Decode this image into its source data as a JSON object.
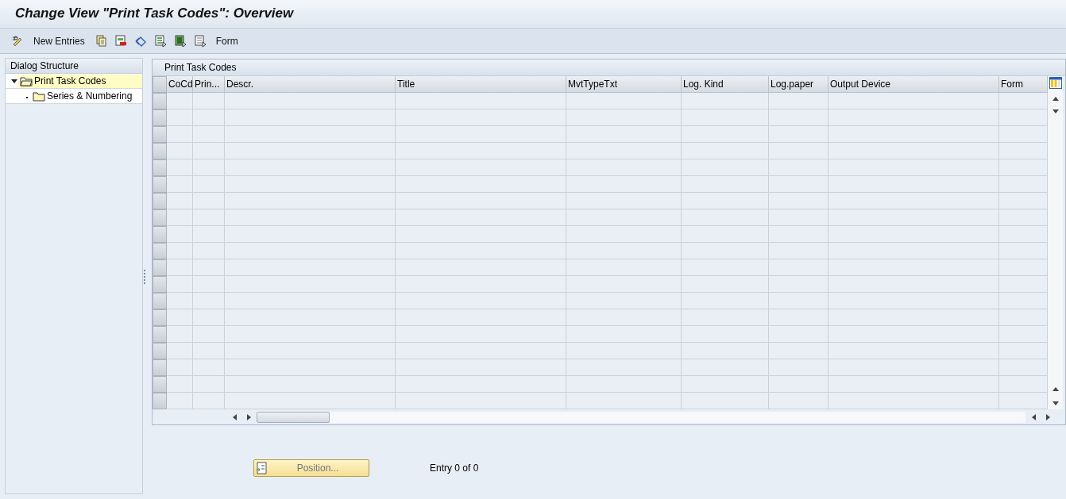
{
  "window": {
    "title": "Change View \"Print Task Codes\": Overview"
  },
  "toolbar": {
    "new_entries": "New Entries",
    "form": "Form"
  },
  "dialog_structure": {
    "title": "Dialog Structure",
    "items": [
      {
        "label": "Print Task Codes",
        "selected": true,
        "expanded": true,
        "children": [
          {
            "label": "Series & Numbering",
            "selected": false
          }
        ]
      }
    ]
  },
  "table": {
    "title": "Print Task Codes",
    "columns": [
      "CoCd",
      "Prin...",
      "Descr.",
      "Title",
      "MvtTypeTxt",
      "Log. Kind",
      "Log.paper",
      "Output Device",
      "Form"
    ],
    "rows": [
      {
        "selected": false
      },
      {
        "selected": false
      },
      {
        "selected": false
      },
      {
        "selected": false
      },
      {
        "selected": false
      },
      {
        "selected": false
      },
      {
        "selected": false
      },
      {
        "selected": false
      },
      {
        "selected": false
      },
      {
        "selected": false
      },
      {
        "selected": false
      },
      {
        "selected": false
      },
      {
        "selected": false
      },
      {
        "selected": false
      },
      {
        "selected": false
      },
      {
        "selected": false
      },
      {
        "selected": false
      },
      {
        "selected": false
      },
      {
        "selected": false
      }
    ]
  },
  "footer": {
    "position_button": "Position...",
    "entry_info": "Entry 0 of 0"
  }
}
